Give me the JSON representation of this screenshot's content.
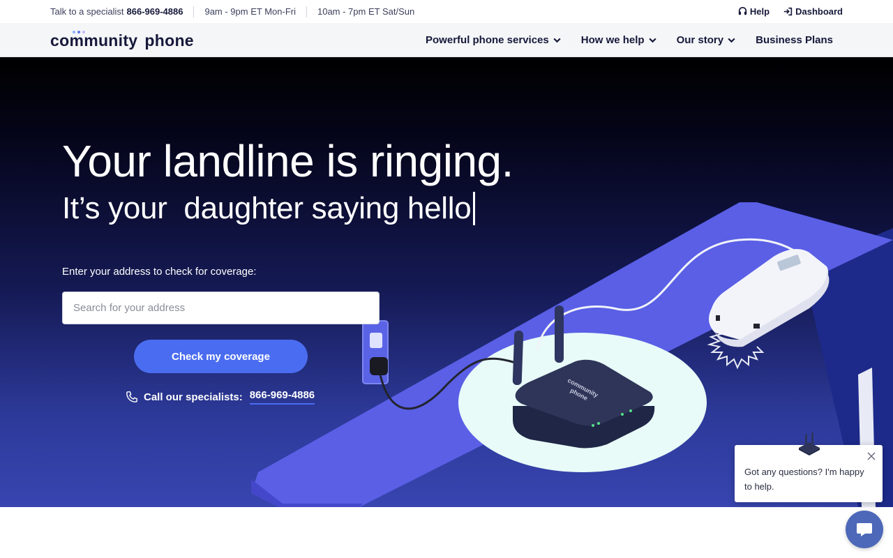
{
  "topbar": {
    "specialist_label": "Talk to a specialist",
    "specialist_phone": "866-969-4886",
    "hours_weekday": "9am - 9pm ET Mon-Fri",
    "hours_weekend": "10am - 7pm ET Sat/Sun",
    "help_label": "Help",
    "dashboard_label": "Dashboard"
  },
  "nav": {
    "logo_word1": "community",
    "logo_word2": "phone",
    "logo_dot_colors": [
      "#8fb3ff",
      "#5b7cf0",
      "#c7b6f5"
    ],
    "items": [
      {
        "label": "Powerful phone services",
        "has_dropdown": true
      },
      {
        "label": "How we help",
        "has_dropdown": true
      },
      {
        "label": "Our story",
        "has_dropdown": true
      },
      {
        "label": "Business Plans",
        "has_dropdown": false
      }
    ]
  },
  "hero": {
    "headline": "Your landline is ringing.",
    "subline": "It’s your  daughter saying hello",
    "coverage_label": "Enter your address to check for coverage:",
    "search_placeholder": "Search for your address",
    "cta_label": "Check my coverage",
    "call_label": "Call our specialists:",
    "call_phone": "866-969-4886",
    "device_brand_line1": "community",
    "device_brand_line2": "phone"
  },
  "chat": {
    "message": "Got any questions? I'm happy to help."
  },
  "colors": {
    "accent": "#4a6cf0",
    "navy": "#16193a",
    "table_purple": "#5a5fe6",
    "chat_fab": "#4d68b8"
  }
}
